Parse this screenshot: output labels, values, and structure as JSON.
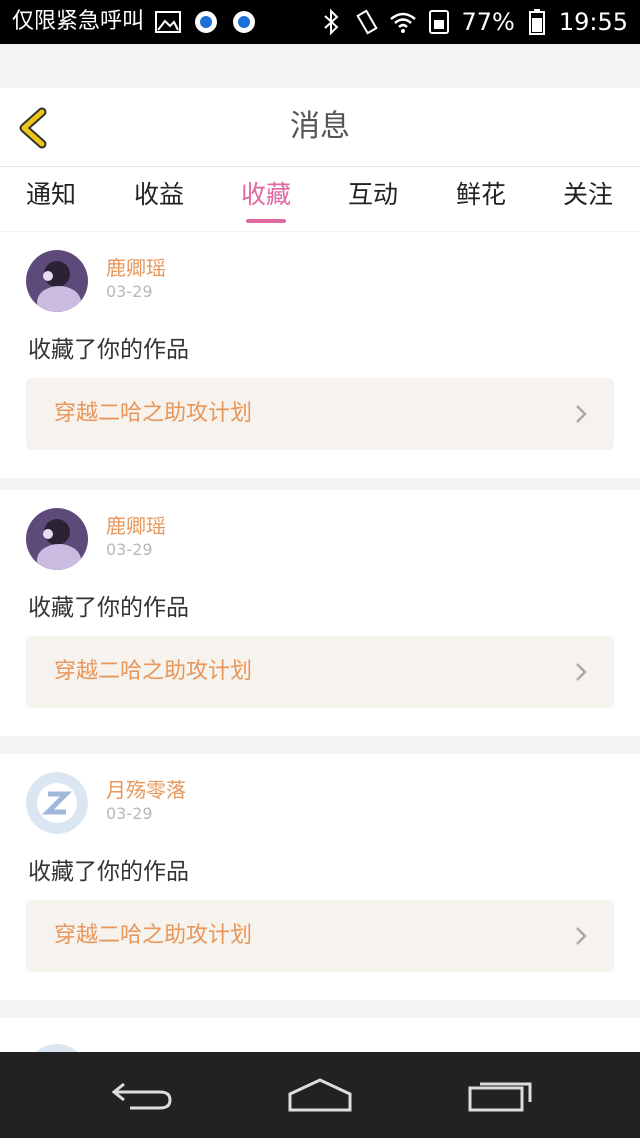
{
  "statusbar": {
    "carrier": "仅限紧急呼叫",
    "battery_pct": "77%",
    "time": "19:55"
  },
  "header": {
    "title": "消息"
  },
  "tabs": [
    {
      "label": "通知",
      "active": false
    },
    {
      "label": "收益",
      "active": false
    },
    {
      "label": "收藏",
      "active": true
    },
    {
      "label": "互动",
      "active": false
    },
    {
      "label": "鲜花",
      "active": false
    },
    {
      "label": "关注",
      "active": false
    }
  ],
  "messages": [
    {
      "user": "鹿卿瑶",
      "date": "03-29",
      "action": "收藏了你的作品",
      "work": "穿越二哈之助攻计划"
    },
    {
      "user": "鹿卿瑶",
      "date": "03-29",
      "action": "收藏了你的作品",
      "work": "穿越二哈之助攻计划"
    },
    {
      "user": "月殇零落",
      "date": "03-29",
      "action": "收藏了你的作品",
      "work": "穿越二哈之助攻计划"
    }
  ],
  "colors": {
    "accent": "#e06aa0",
    "name": "#e8965a",
    "back": "#f0c419"
  }
}
